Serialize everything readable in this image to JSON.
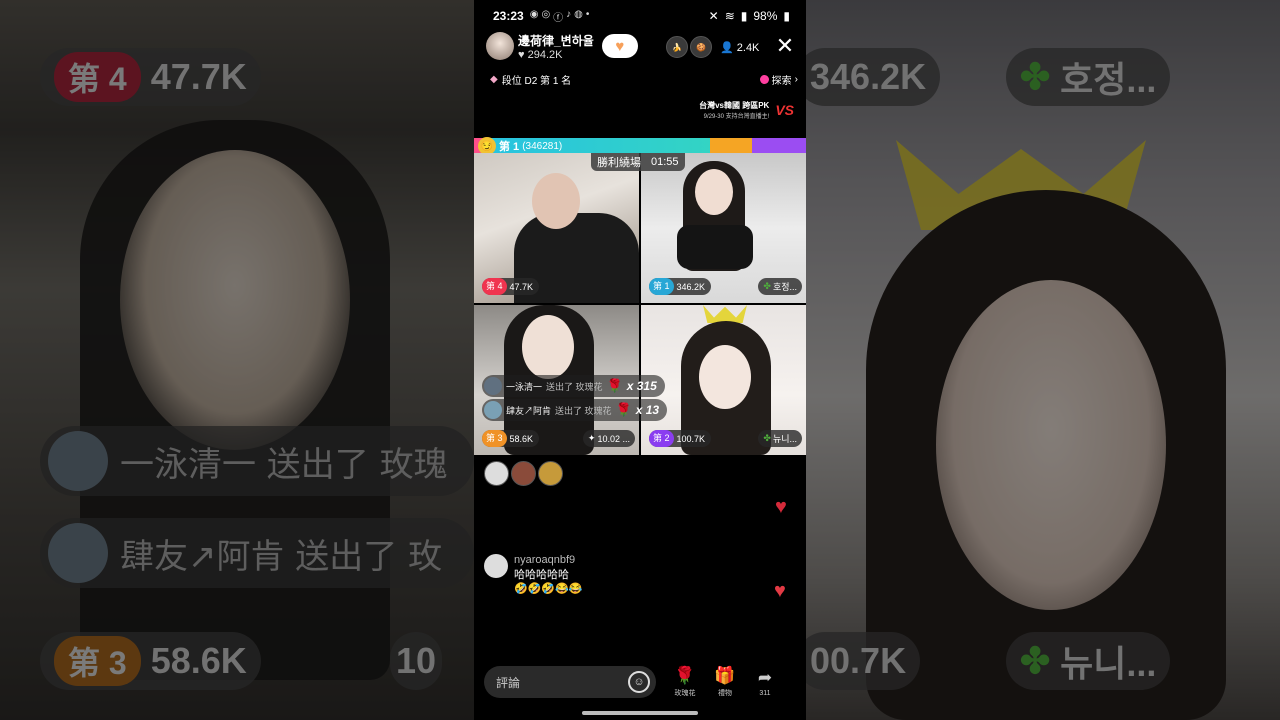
{
  "status_bar": {
    "time": "23:23",
    "battery": "98%"
  },
  "host": {
    "name": "邊荷律_변하율",
    "likes": "294.2K"
  },
  "viewers": {
    "count": "2.4K"
  },
  "rank": {
    "text": "段位 D2 第 1 名",
    "explore_label": "探索"
  },
  "promo": {
    "title": "台灣vs韓國 跨區PK",
    "subtitle": "9/29-30 支持台灣直播主!",
    "vs_label": "VS"
  },
  "pk": {
    "leader_label": "第 1",
    "leader_score": "(346281)",
    "result_label": "勝利繞場",
    "timer": "01:55"
  },
  "cells": [
    {
      "rank": "第 4",
      "score": "47.7K"
    },
    {
      "rank": "第 1",
      "score": "346.2K",
      "tag": "호정..."
    },
    {
      "rank": "第 3",
      "score": "58.6K",
      "tag": "10.02 ..."
    },
    {
      "rank": "第 2",
      "score": "100.7K",
      "tag": "뉴니..."
    }
  ],
  "gift_messages": [
    {
      "user": "一泳清一",
      "action": "送出了 玫瑰花",
      "multiplier": "x 315"
    },
    {
      "user": "肆友↗阿肯",
      "action": "送出了 玫瑰花",
      "multiplier": "x 13"
    }
  ],
  "comment": {
    "user": "nyaroaqnbf9",
    "text": "哈哈哈哈哈",
    "emojis": "🤣🤣🤣😂😂"
  },
  "bottom": {
    "placeholder": "評論",
    "rose_label": "玫瑰花",
    "gift_label": "禮物",
    "share_count": "311"
  },
  "background": {
    "top_left": {
      "rank": "第 4",
      "score": "47.7K"
    },
    "top_right": {
      "score": "346.2K",
      "tag": "호정..."
    },
    "comment1": "一泳清一 送出了 玫瑰",
    "comment2": "肆友↗阿肯 送出了 玫",
    "bottom_left": {
      "rank": "第 3",
      "score": "58.6K",
      "tag": "10"
    },
    "bottom_right": {
      "score": "00.7K",
      "tag": "뉴니..."
    }
  },
  "colors": {
    "rank4": "#f0344f",
    "rank1": "#28a7d6",
    "rank3": "#f09227",
    "rank2": "#8a3df0",
    "heart": "#d42a3a"
  }
}
